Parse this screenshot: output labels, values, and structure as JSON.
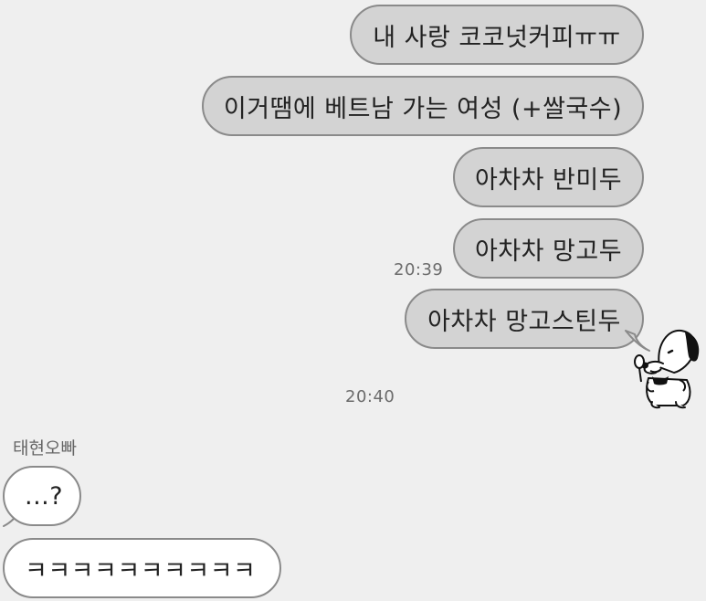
{
  "messages": {
    "sent_1": "내 사랑 코코넛커피ㅠㅠ",
    "sent_2": "이거땜에 베트남 가는 여성 (+쌀국수)",
    "sent_3": "아차차 반미두",
    "sent_4": "아차차 망고두",
    "sent_5": "아차차 망고스틴두",
    "recv_1": "...?",
    "recv_2": "ㅋㅋㅋㅋㅋㅋㅋㅋㅋㅋ"
  },
  "timestamps": {
    "t1": "20:39",
    "t2": "20:40"
  },
  "sender": {
    "name": "태현오빠"
  },
  "stickers": {
    "sticker_1": "snoopy-eating-sticker"
  },
  "colors": {
    "background": "#efefef",
    "sent_bubble": "#d3d3d3",
    "recv_bubble": "#ffffff",
    "bubble_border": "#8a8a8a"
  }
}
